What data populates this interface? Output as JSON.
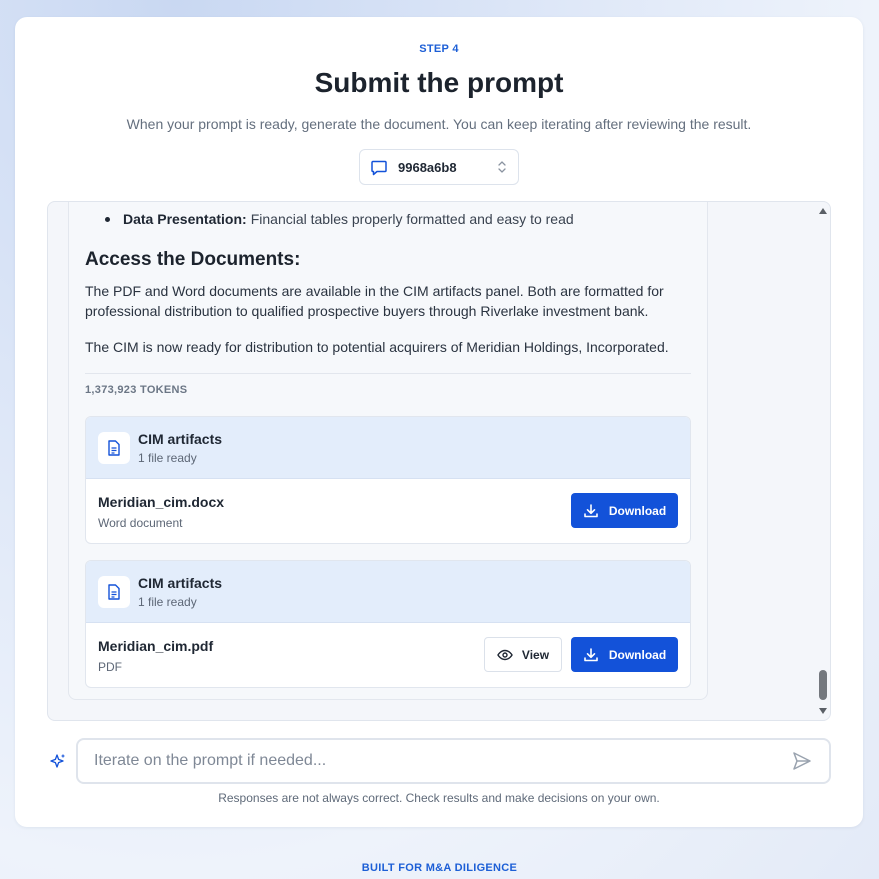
{
  "step": {
    "label": "STEP 4"
  },
  "header": {
    "title": "Submit the prompt",
    "subtitle": "When your prompt is ready, generate the document. You can keep iterating after reviewing the result."
  },
  "session_selector": {
    "value": "9968a6b8",
    "icon": "chat-icon"
  },
  "message": {
    "bullet_label": "Data Presentation:",
    "bullet_text": "Financial tables properly formatted and easy to read",
    "heading": "Access the Documents:",
    "paragraph1": "The PDF and Word documents are available in the CIM artifacts panel. Both are formatted for professional distribution to qualified prospective buyers through Riverlake investment bank.",
    "paragraph2": "The CIM is now ready for distribution to potential acquirers of Meridian Holdings, Incorporated.",
    "tokens": "1,373,923 TOKENS"
  },
  "artifacts": [
    {
      "title": "CIM artifacts",
      "status": "1 file ready",
      "file_name": "Meridian_cim.docx",
      "file_type": "Word document",
      "download_label": "Download"
    },
    {
      "title": "CIM artifacts",
      "status": "1 file ready",
      "file_name": "Meridian_cim.pdf",
      "file_type": "PDF",
      "view_label": "View",
      "download_label": "Download"
    }
  ],
  "prompt_input": {
    "placeholder": "Iterate on the prompt if needed..."
  },
  "disclaimer": "Responses are not always correct. Check results and make decisions on your own.",
  "footer": "BUILT FOR M&A DILIGENCE",
  "colors": {
    "accent": "#1352d9",
    "artifact_header": "#e3edfb"
  }
}
